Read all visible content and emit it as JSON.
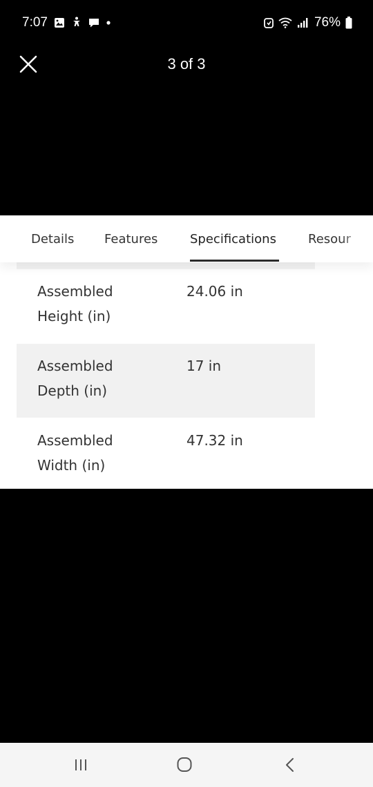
{
  "status_bar": {
    "time": "7:07",
    "battery": "76%",
    "left_icons": [
      "gallery-icon",
      "accessibility-icon",
      "message-icon",
      "dot-icon"
    ],
    "right_icons": [
      "alarm-icon",
      "wifi-icon",
      "signal-icon",
      "battery-icon"
    ]
  },
  "viewer": {
    "counter": "3 of 3",
    "close_icon": "close-icon"
  },
  "tabs": [
    {
      "label": "Details",
      "active": false
    },
    {
      "label": "Features",
      "active": false
    },
    {
      "label": "Specifications",
      "active": true
    },
    {
      "label": "Resour",
      "active": false
    }
  ],
  "specs": [
    {
      "label": "Assembled Height (in)",
      "value": "24.06 in"
    },
    {
      "label": "Assembled Depth (in)",
      "value": "17 in"
    },
    {
      "label": "Assembled Width (in)",
      "value": "47.32 in"
    }
  ],
  "nav_bar": {
    "icons": [
      "recents-icon",
      "home-icon",
      "back-icon"
    ]
  },
  "colors": {
    "background": "#000000",
    "panel": "#ffffff",
    "row_shade": "#f1f1f1",
    "text": "#333333",
    "nav_bar": "#f5f5f5"
  }
}
